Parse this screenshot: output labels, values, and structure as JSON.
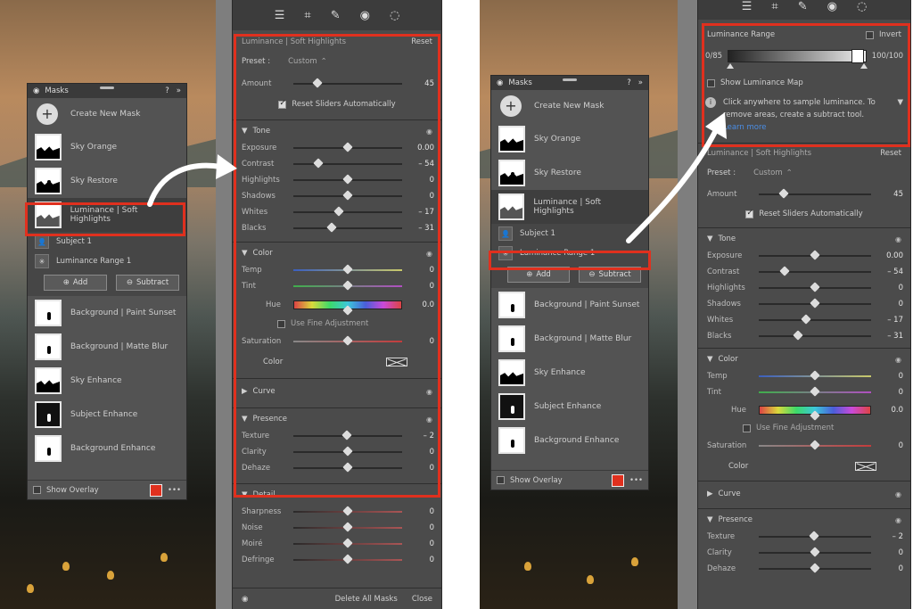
{
  "left": {
    "masks_panel": {
      "title": "Masks",
      "create_label": "Create New Mask",
      "masks": [
        {
          "label": "Sky Orange",
          "thumb": "sky"
        },
        {
          "label": "Sky Restore",
          "thumb": "sky-figure"
        },
        {
          "label": "Luminance | Soft Highlights",
          "thumb": "luminance",
          "selected": true
        },
        {
          "label": "Background | Paint Sunset",
          "thumb": "figure"
        },
        {
          "label": "Background | Matte Blur",
          "thumb": "figure"
        },
        {
          "label": "Sky Enhance",
          "thumb": "sky"
        },
        {
          "label": "Subject Enhance",
          "thumb": "subject"
        },
        {
          "label": "Background Enhance",
          "thumb": "figure"
        }
      ],
      "components": [
        "Subject 1",
        "Luminance Range 1"
      ],
      "add_label": "Add",
      "subtract_label": "Subtract",
      "show_overlay_label": "Show Overlay",
      "overlay_color": "#e0301e"
    },
    "edit_panel": {
      "mask_name": "Luminance | Soft Highlights",
      "reset_label": "Reset",
      "preset_label": "Preset :",
      "preset_value": "Custom",
      "amount_label": "Amount",
      "amount_value": "45",
      "reset_auto_label": "Reset Sliders Automatically",
      "tone": {
        "title": "Tone",
        "sliders": [
          {
            "label": "Exposure",
            "value": "0.00",
            "pos": 0.5
          },
          {
            "label": "Contrast",
            "value": "– 54",
            "pos": 0.23
          },
          {
            "label": "Highlights",
            "value": "0",
            "pos": 0.5
          },
          {
            "label": "Shadows",
            "value": "0",
            "pos": 0.5
          },
          {
            "label": "Whites",
            "value": "– 17",
            "pos": 0.42
          },
          {
            "label": "Blacks",
            "value": "– 31",
            "pos": 0.35
          }
        ]
      },
      "color": {
        "title": "Color",
        "temp_label": "Temp",
        "temp_value": "0",
        "tint_label": "Tint",
        "tint_value": "0",
        "hue_label": "Hue",
        "hue_value": "0.0",
        "fine_label": "Use Fine Adjustment",
        "saturation_label": "Saturation",
        "saturation_value": "0",
        "color_label": "Color"
      },
      "curve": {
        "title": "Curve"
      },
      "presence": {
        "title": "Presence",
        "sliders": [
          {
            "label": "Texture",
            "value": "– 2",
            "pos": 0.49
          },
          {
            "label": "Clarity",
            "value": "0",
            "pos": 0.5
          },
          {
            "label": "Dehaze",
            "value": "0",
            "pos": 0.5
          }
        ]
      },
      "detail": {
        "title": "Detail",
        "sliders": [
          {
            "label": "Sharpness",
            "value": "0",
            "pos": 0.5
          },
          {
            "label": "Noise",
            "value": "0",
            "pos": 0.5
          },
          {
            "label": "Moiré",
            "value": "0",
            "pos": 0.5
          },
          {
            "label": "Defringe",
            "value": "0",
            "pos": 0.5
          }
        ]
      },
      "footer": {
        "delete_label": "Delete All Masks",
        "close_label": "Close"
      }
    }
  },
  "right": {
    "masks_panel": {
      "create_label": "Create New Mask",
      "masks": [
        {
          "label": "Sky Orange",
          "thumb": "sky"
        },
        {
          "label": "Sky Restore",
          "thumb": "sky-figure"
        },
        {
          "label": "Luminance | Soft Highlights",
          "thumb": "luminance",
          "selected": true
        },
        {
          "label": "Background | Paint Sunset",
          "thumb": "figure"
        },
        {
          "label": "Background | Matte Blur",
          "thumb": "figure"
        },
        {
          "label": "Sky Enhance",
          "thumb": "sky"
        },
        {
          "label": "Subject Enhance",
          "thumb": "subject"
        },
        {
          "label": "Background Enhance",
          "thumb": "figure"
        }
      ],
      "components": [
        "Subject 1",
        "Luminance Range 1"
      ],
      "add_label": "Add",
      "subtract_label": "Subtract",
      "show_overlay_label": "Show Overlay"
    },
    "edit_panel": {
      "lum_title": "Luminance Range",
      "invert_label": "Invert",
      "range_low": "0/85",
      "range_high": "100/100",
      "show_map_label": "Show Luminance Map",
      "info_text": "Click anywhere to sample luminance. To remove areas, create a subtract tool.",
      "learn_more": "Learn more",
      "mask_name": "Luminance | Soft Highlights",
      "reset_label": "Reset",
      "preset_label": "Preset :",
      "preset_value": "Custom",
      "amount_label": "Amount",
      "amount_value": "45",
      "reset_auto_label": "Reset Sliders Automatically",
      "tone_title": "Tone",
      "color_title": "Color",
      "curve_title": "Curve",
      "presence_title": "Presence"
    }
  }
}
